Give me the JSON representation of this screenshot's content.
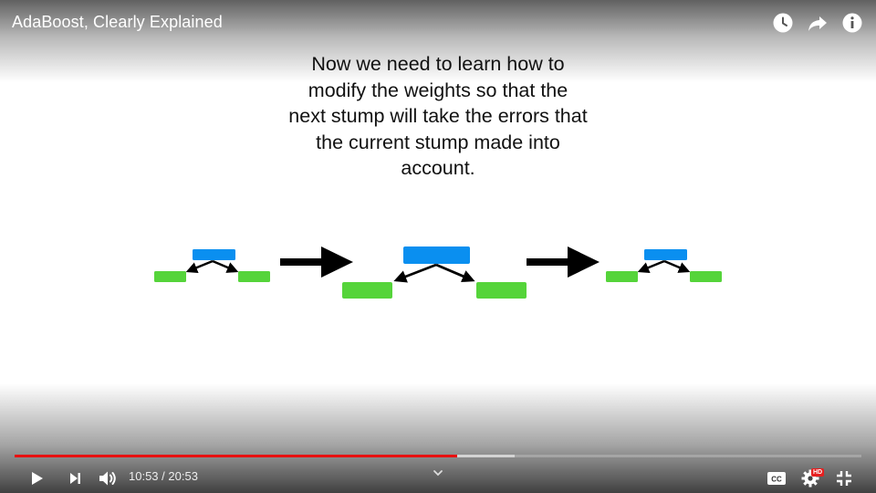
{
  "video": {
    "title": "AdaBoost, Clearly Explained"
  },
  "slide": {
    "caption_lines": [
      "Now we need to learn how to",
      "modify the weights so that the",
      "next stump will take the errors that",
      "the current stump made into",
      "account."
    ],
    "colors": {
      "stump_root": "#0a8ff0",
      "stump_leaf": "#55d43a",
      "arrow": "#000000"
    }
  },
  "player": {
    "progress": {
      "played_fraction": 0.523,
      "buffered_fraction": 0.591
    },
    "time": {
      "current": "10:53",
      "separator": " / ",
      "duration": "20:53"
    },
    "hd_label": "HD",
    "icons": {
      "top": [
        "watch-later-icon",
        "share-icon",
        "info-icon"
      ],
      "bottom_left": [
        "play-icon",
        "next-icon",
        "volume-icon"
      ],
      "bottom_right": [
        "closed-captions-icon",
        "settings-icon",
        "exit-fullscreen-icon"
      ]
    }
  }
}
